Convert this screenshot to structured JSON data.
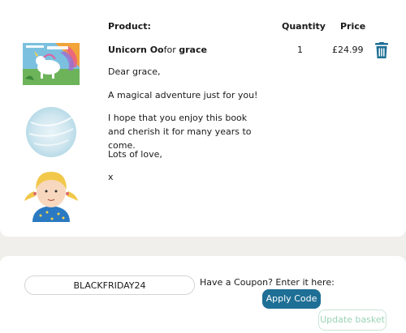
{
  "table": {
    "header_product": "Product:",
    "header_quantity": "Quantity",
    "header_price": "Price"
  },
  "item": {
    "name_bold_1": "Unicorn Oo",
    "name_normal": "for",
    "name_bold_2": "grace",
    "quantity": "1",
    "price": "£24.99",
    "remove_icon": "trash-icon",
    "accent_color": "#1e6f95"
  },
  "message": {
    "line1": "Dear grace,",
    "line2": "A magical adventure just for you!",
    "line3": "I hope that you enjoy this book and cherish it for many years to come.",
    "line4": "Lots of love,",
    "line5": "x"
  },
  "coupon": {
    "value": "BLACKFRIDAY24",
    "label": "Have a Coupon? Enter it here:",
    "apply_label": "Apply Code",
    "update_label": "Update basket"
  }
}
